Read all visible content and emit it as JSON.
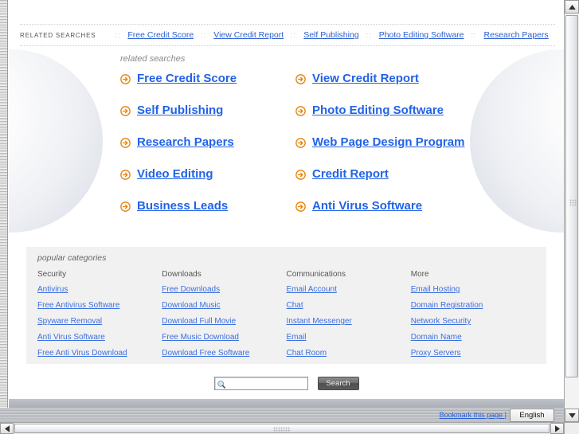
{
  "topstrip": {
    "label": "RELATED SEARCHES",
    "separator": "::",
    "links": [
      "Free Credit Score",
      "View Credit Report",
      "Self Publishing",
      "Photo Editing Software",
      "Research Papers"
    ]
  },
  "related_searches": {
    "heading": "related searches",
    "icon": "circle-arrow-right-icon",
    "items": [
      "Free Credit Score",
      "View Credit Report",
      "Self Publishing",
      "Photo Editing Software",
      "Research Papers",
      "Web Page Design Program",
      "Video Editing",
      "Credit Report",
      "Business Leads",
      "Anti Virus Software"
    ]
  },
  "popular_categories": {
    "heading": "popular categories",
    "columns": [
      {
        "title": "Security",
        "links": [
          "Antivirus",
          "Free Antivirus Software",
          "Spyware Removal",
          "Anti Virus Software",
          "Free Anti Virus Download"
        ]
      },
      {
        "title": "Downloads",
        "links": [
          "Free Downloads",
          "Download Music",
          "Download Full Movie",
          "Free Music Download",
          "Download Free Software"
        ]
      },
      {
        "title": "Communications",
        "links": [
          "Email Account",
          "Chat",
          "Instant Messenger",
          "Email",
          "Chat Room"
        ]
      },
      {
        "title": "More",
        "links": [
          "Email Hosting",
          "Domain Registration",
          "Network Security",
          "Domain Name",
          "Proxy Servers"
        ]
      }
    ]
  },
  "search": {
    "icon": "magnifier-icon",
    "value": "",
    "placeholder": "",
    "button_label": "Search"
  },
  "statusbar": {
    "bookmark_label": "Bookmark this page |",
    "language": "English"
  },
  "scrollbars": {
    "up_icon": "triangle-up-icon",
    "down_icon": "triangle-down-icon",
    "left_icon": "triangle-left-icon",
    "right_icon": "triangle-right-icon"
  },
  "colors": {
    "link_blue": "#2263e6",
    "small_link_blue": "#3b6fe0",
    "arrow_orange": "#e8820c",
    "panel_gray": "#f1f1f1"
  }
}
